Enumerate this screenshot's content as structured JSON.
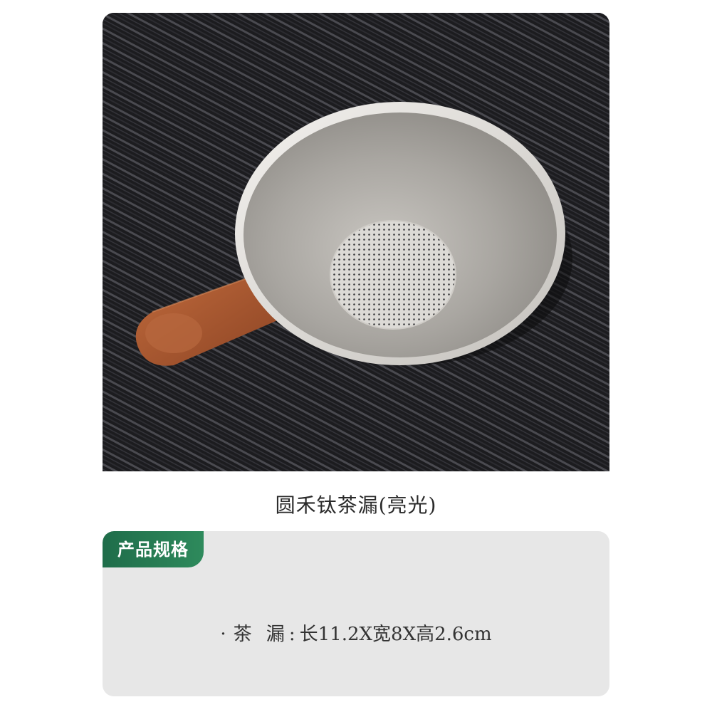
{
  "product": {
    "image_subject": "titanium-tea-strainer",
    "title": "圆禾钛茶漏(亮光)"
  },
  "spec": {
    "tag_label": "产品规格",
    "bullet": "·",
    "key": "茶 漏:",
    "value": "长11.2X宽8X高2.6cm"
  },
  "colors": {
    "accent": "#2e8a5c",
    "card_bg": "#e7e7e7",
    "wood": "#a85a34"
  }
}
